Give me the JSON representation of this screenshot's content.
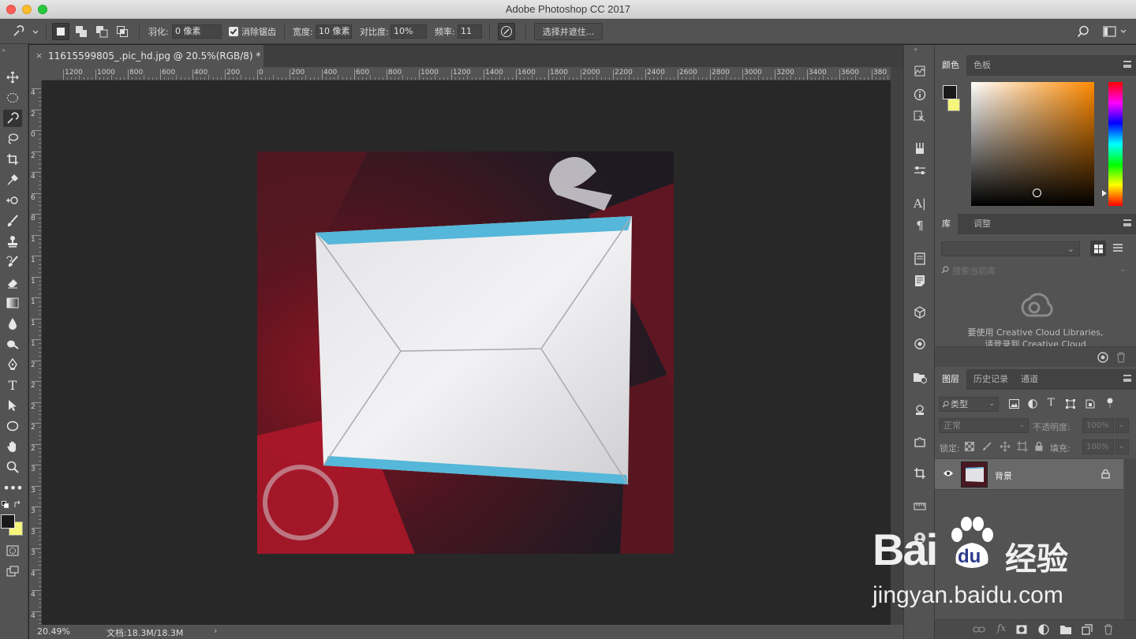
{
  "window": {
    "title": "Adobe Photoshop CC 2017"
  },
  "options_bar": {
    "feather_label": "羽化:",
    "feather_value": "0 像素",
    "antialias_label": "消除锯齿",
    "antialias_checked": true,
    "width_label": "宽度:",
    "width_value": "10 像素",
    "contrast_label": "对比度:",
    "contrast_value": "10%",
    "frequency_label": "频率:",
    "frequency_value": "11",
    "select_mask_button": "选择并遮住..."
  },
  "document": {
    "tab_title": "11615599805_.pic_hd.jpg @ 20.5%(RGB/8) *",
    "zoom": "20.49%",
    "doc_size": "文档:18.3M/18.3M"
  },
  "rulers": {
    "horizontal": [
      "1200",
      "1000",
      "800",
      "600",
      "400",
      "200",
      "0",
      "200",
      "400",
      "600",
      "800",
      "1000",
      "1200",
      "1400",
      "1600",
      "1800",
      "2000",
      "2200",
      "2400",
      "2600",
      "2800",
      "3000",
      "3200",
      "3400",
      "3600",
      "380"
    ],
    "vertical": [
      "4",
      "2",
      "0",
      "2",
      "4",
      "6",
      "8",
      "1",
      "1",
      "1",
      "1",
      "1",
      "1",
      "2",
      "2",
      "2",
      "2",
      "2",
      "3",
      "3",
      "3",
      "3",
      "3",
      "4",
      "4",
      "4"
    ]
  },
  "color_panel": {
    "tabs": [
      "颜色",
      "色板"
    ],
    "foreground": "#1a1a1a",
    "background": "#f5f57a",
    "hue_color": "#ff8a00"
  },
  "libraries_panel": {
    "tabs": [
      "库",
      "调整"
    ],
    "search_placeholder": "搜索当前库",
    "message_line1": "要使用 Creative Cloud Libraries,",
    "message_line2": "请登录到 Creative Cloud"
  },
  "layers_panel": {
    "tabs": [
      "图层",
      "历史记录",
      "通道"
    ],
    "filter_label": "类型",
    "blend_mode": "正常",
    "opacity_label": "不透明度:",
    "opacity_value": "100%",
    "lock_label": "锁定:",
    "fill_label": "填充:",
    "fill_value": "100%",
    "layers": [
      {
        "name": "背景",
        "visible": true,
        "locked": true
      }
    ]
  },
  "watermark": {
    "brand": "Bai",
    "paw": "du",
    "chinese": "经验",
    "url": "jingyan.baidu.com"
  }
}
